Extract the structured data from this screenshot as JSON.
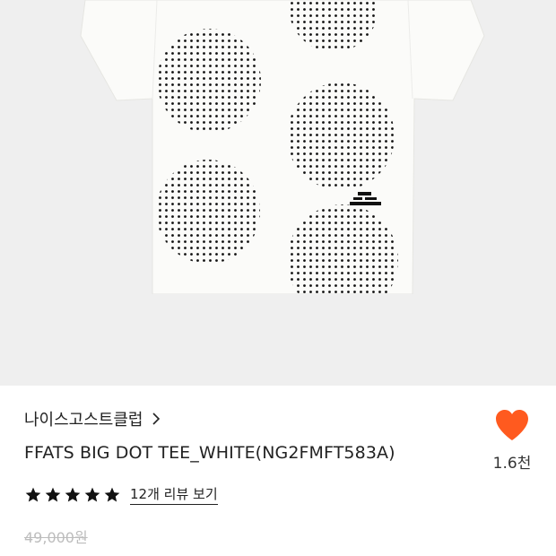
{
  "product": {
    "brand": "나이스고스트클럽",
    "brand_link_icon": "chevron-right-icon",
    "title": "FFATS BIG DOT TEE_WHITE(NG2FMFT583A)",
    "rating_stars": 5,
    "review_link": "12개 리뷰 보기",
    "original_price": "49,000원",
    "like_count": "1.6천",
    "like_icon": "heart-icon"
  },
  "colors": {
    "image_background": "#efefef",
    "heart": "#ff5a1f",
    "star": "#111111",
    "strike_price": "#bdbdbd"
  }
}
